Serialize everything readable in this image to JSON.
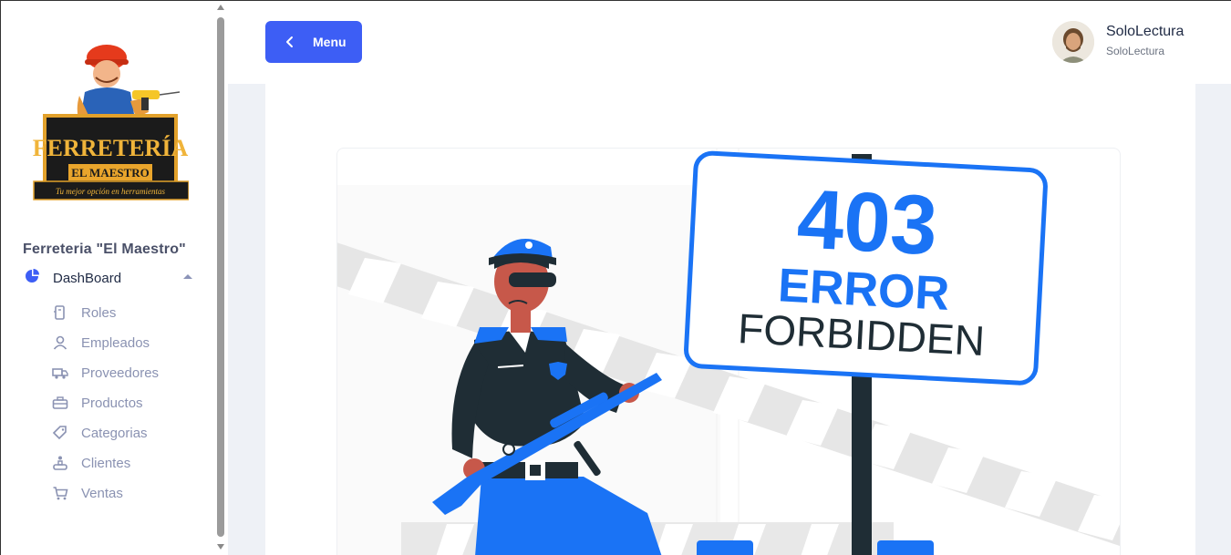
{
  "brand": {
    "name": "Ferreteria \"El Maestro\"",
    "logo_line1": "FERRETERÍA",
    "logo_line2": "EL MAESTRO",
    "logo_tagline": "Tu mejor opción en herramientas"
  },
  "sidebar": {
    "dashboard_label": "DashBoard",
    "items": [
      {
        "label": "Roles",
        "icon": "id-card-icon"
      },
      {
        "label": "Empleados",
        "icon": "user-icon"
      },
      {
        "label": "Proveedores",
        "icon": "truck-icon"
      },
      {
        "label": "Productos",
        "icon": "toolbox-icon"
      },
      {
        "label": "Categorias",
        "icon": "tag-icon"
      },
      {
        "label": "Clientes",
        "icon": "customer-icon"
      },
      {
        "label": "Ventas",
        "icon": "cart-icon"
      }
    ]
  },
  "header": {
    "menu_label": "Menu",
    "user_name": "SoloLectura",
    "user_role": "SoloLectura"
  },
  "error_sign": {
    "code": "403",
    "title": "ERROR",
    "subtitle": "FORBIDDEN"
  },
  "colors": {
    "accent": "#3d5ef5",
    "illustration_blue": "#1a73f5",
    "text_muted": "#8a92b2"
  }
}
